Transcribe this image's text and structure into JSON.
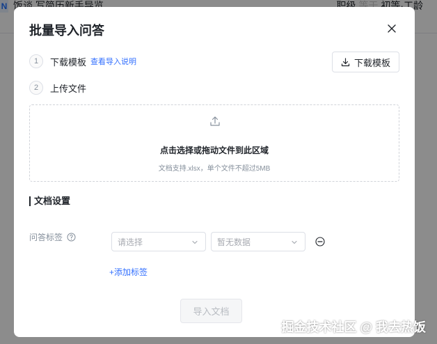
{
  "background": {
    "logo_text": "N",
    "title": "饭谈 写简历新手导览",
    "right_prefix": "职级",
    "right_accent": "等于",
    "right_suffix": "初等·工龄"
  },
  "modal": {
    "title": "批量导入问答",
    "steps": [
      {
        "num": "1",
        "label": "下载模板",
        "link": "查看导入说明"
      },
      {
        "num": "2",
        "label": "上传文件"
      }
    ],
    "download_button": "下载模板",
    "dropzone": {
      "main": "点击选择或拖动文件到此区域",
      "hint": "文档支持.xlsx，单个文件不超过5MB"
    },
    "settings_title": "文档设置",
    "tag_field": {
      "label": "问答标签",
      "select1_placeholder": "请选择",
      "select2_placeholder": "暂无数据",
      "add_tag": "+添加标签"
    },
    "import_button": "导入文档"
  },
  "watermark": "掘金技术社区 @ 我去热饭"
}
